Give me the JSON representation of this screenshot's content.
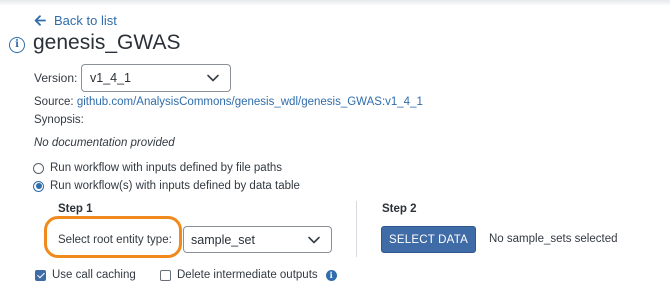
{
  "nav": {
    "back_label": "Back to list"
  },
  "workflow": {
    "title": "genesis_GWAS",
    "version_label": "Version:",
    "version_value": "v1_4_1",
    "source_label": "Source:",
    "source_link": "github.com/AnalysisCommons/genesis_wdl/genesis_GWAS:v1_4_1",
    "synopsis_label": "Synopsis:",
    "documentation": "No documentation provided"
  },
  "input_mode": {
    "options": [
      {
        "label": "Run workflow with inputs defined by file paths",
        "selected": false
      },
      {
        "label": "Run workflow(s) with inputs defined by data table",
        "selected": true
      }
    ]
  },
  "step1": {
    "heading": "Step 1",
    "root_entity_label": "Select root entity type:",
    "root_entity_value": "sample_set"
  },
  "step2": {
    "heading": "Step 2",
    "select_data_label": "SELECT DATA",
    "status_text": "No sample_sets selected"
  },
  "options": {
    "use_call_caching": {
      "label": "Use call caching",
      "checked": true
    },
    "delete_intermediate": {
      "label": "Delete intermediate outputs",
      "checked": false
    }
  },
  "colors": {
    "accent": "#2f6dac",
    "button": "#3f6ba7",
    "highlight": "#f08a1c"
  },
  "icons": [
    "arrow-left-icon",
    "info-icon",
    "chevron-down-icon",
    "info-filled-icon"
  ]
}
